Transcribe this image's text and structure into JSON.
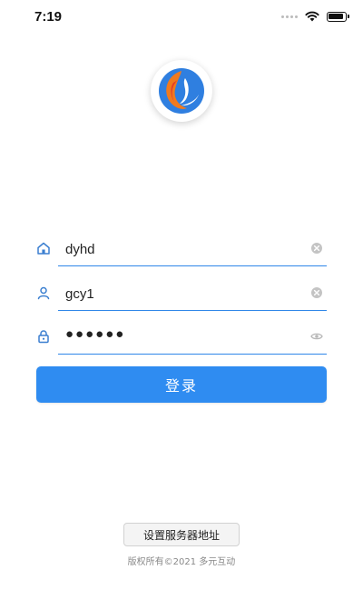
{
  "status_bar": {
    "time": "7:19",
    "icons": [
      "signal-dots-icon",
      "wifi-icon",
      "battery-icon"
    ]
  },
  "logo": {
    "icon": "app-logo-icon",
    "colors": {
      "blue": "#2f7fe0",
      "orange": "#f07a1e",
      "red": "#e23a2a"
    }
  },
  "form": {
    "server": {
      "icon": "home-icon",
      "value": "dyhd",
      "action_icon": "clear-icon"
    },
    "username": {
      "icon": "user-icon",
      "value": "gcy1",
      "action_icon": "clear-icon"
    },
    "password": {
      "icon": "lock-icon",
      "value": "●●●●●●",
      "action_icon": "eye-icon"
    }
  },
  "login_button": {
    "label": "登录"
  },
  "server_settings_button": {
    "label": "设置服务器地址"
  },
  "footer": {
    "copyright": "版权所有©2021 多元互动"
  },
  "colors": {
    "accent": "#2f8cf1",
    "underline": "#2f86e8",
    "icon": "#3b7fd0"
  }
}
